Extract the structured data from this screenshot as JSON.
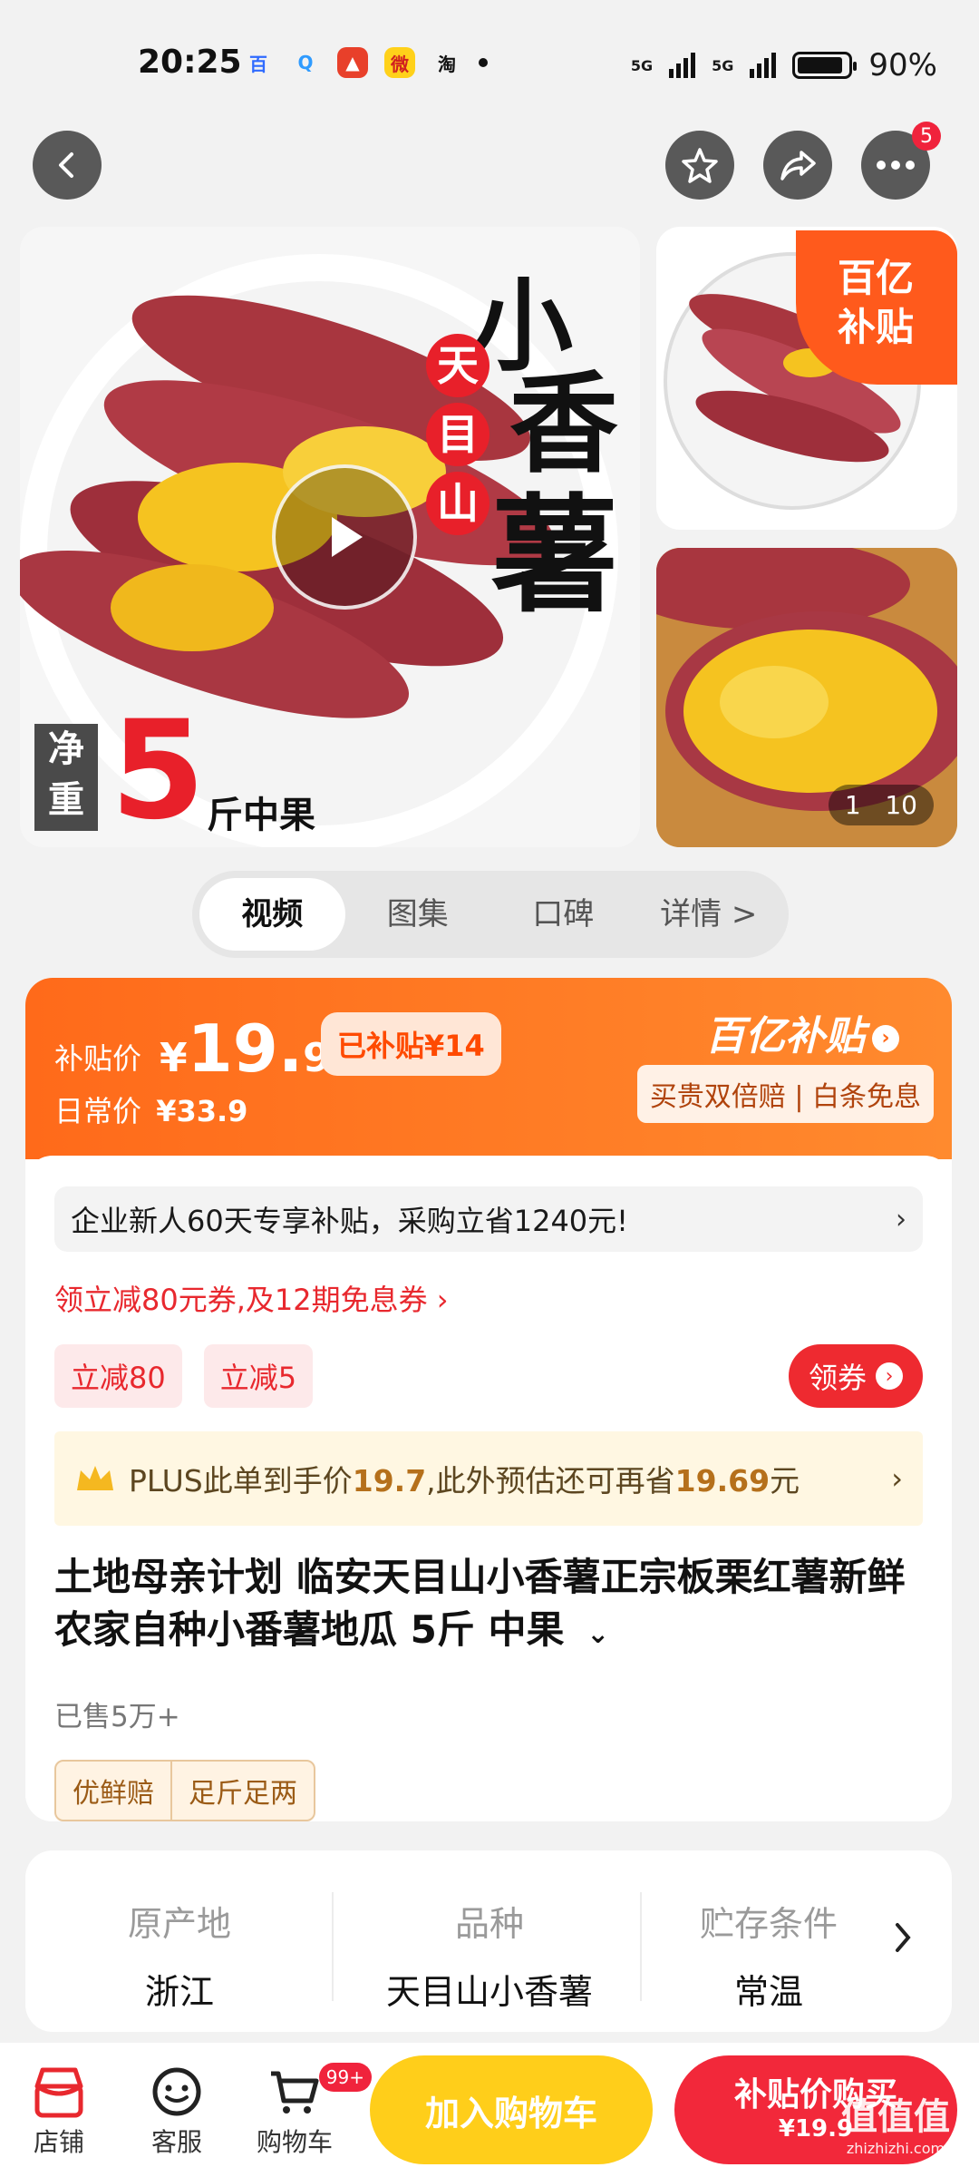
{
  "status_bar": {
    "time": "20:25",
    "apps": [
      "百",
      "Q",
      "▲",
      "微",
      "淘"
    ],
    "network1": "5G",
    "network2": "5G",
    "battery": "90%",
    "battery_level": 0.9
  },
  "nav": {
    "more_badge": "5"
  },
  "gallery": {
    "main_title_1": "小",
    "main_title_2": "香",
    "main_title_3": "薯",
    "main_sub_1": "天",
    "main_sub_2": "目",
    "main_sub_3": "山",
    "weight_label_1": "净",
    "weight_label_2": "重",
    "weight_number": "5",
    "weight_unit": "斤中果",
    "ribbon_1": "百亿",
    "ribbon_2": "补贴",
    "counter_current": "1",
    "counter_total": "10"
  },
  "media_tabs": [
    {
      "label": "视频"
    },
    {
      "label": "图集"
    },
    {
      "label": "口碑"
    },
    {
      "label": "详情 >"
    }
  ],
  "price": {
    "subsidy_label": "补贴价",
    "currency": "¥",
    "price_int": "19.",
    "price_dec": "9",
    "already_subsidized": "已补贴¥14",
    "regular_label": "日常价",
    "regular_price": "¥33.9",
    "brand": "百亿补贴",
    "guarantee": "买贵双倍赔 | 白条免息"
  },
  "promo": {
    "enterprise": "企业新人60天专享补贴，采购立省1240元!",
    "coupon_link": "领立减80元券,及12期免息券 ›",
    "chips": [
      "立减80",
      "立减5"
    ],
    "get_coupon": "领券"
  },
  "plus": {
    "part1": "PLUS此单到手价",
    "price1": "19.7",
    "part2": ",此外预估还可再省",
    "price2": "19.69",
    "part3": "元"
  },
  "product": {
    "title": "土地母亲计划 临安天目山小香薯正宗板栗红薯新鲜农家自种小番薯地瓜 5斤 中果",
    "sold": "已售5万+",
    "tags": [
      "优鲜赔",
      "足斤足两"
    ]
  },
  "attributes": [
    {
      "key": "原产地",
      "value": "浙江"
    },
    {
      "key": "品种",
      "value": "天目山小香薯"
    },
    {
      "key": "贮存条件",
      "value": "常温"
    }
  ],
  "bottom_bar": {
    "shop": "店铺",
    "service": "客服",
    "cart": "购物车",
    "cart_badge": "99+",
    "add_to_cart": "加入购物车",
    "buy_line1": "补贴价购买",
    "buy_line2": "¥19.9",
    "watermark": "值值值",
    "watermark_sub": "zhizhizhi.com"
  },
  "colors": {
    "accent_orange": "#ff6a1a",
    "accent_red": "#f2283a",
    "yellow_button": "#ffce1a"
  }
}
